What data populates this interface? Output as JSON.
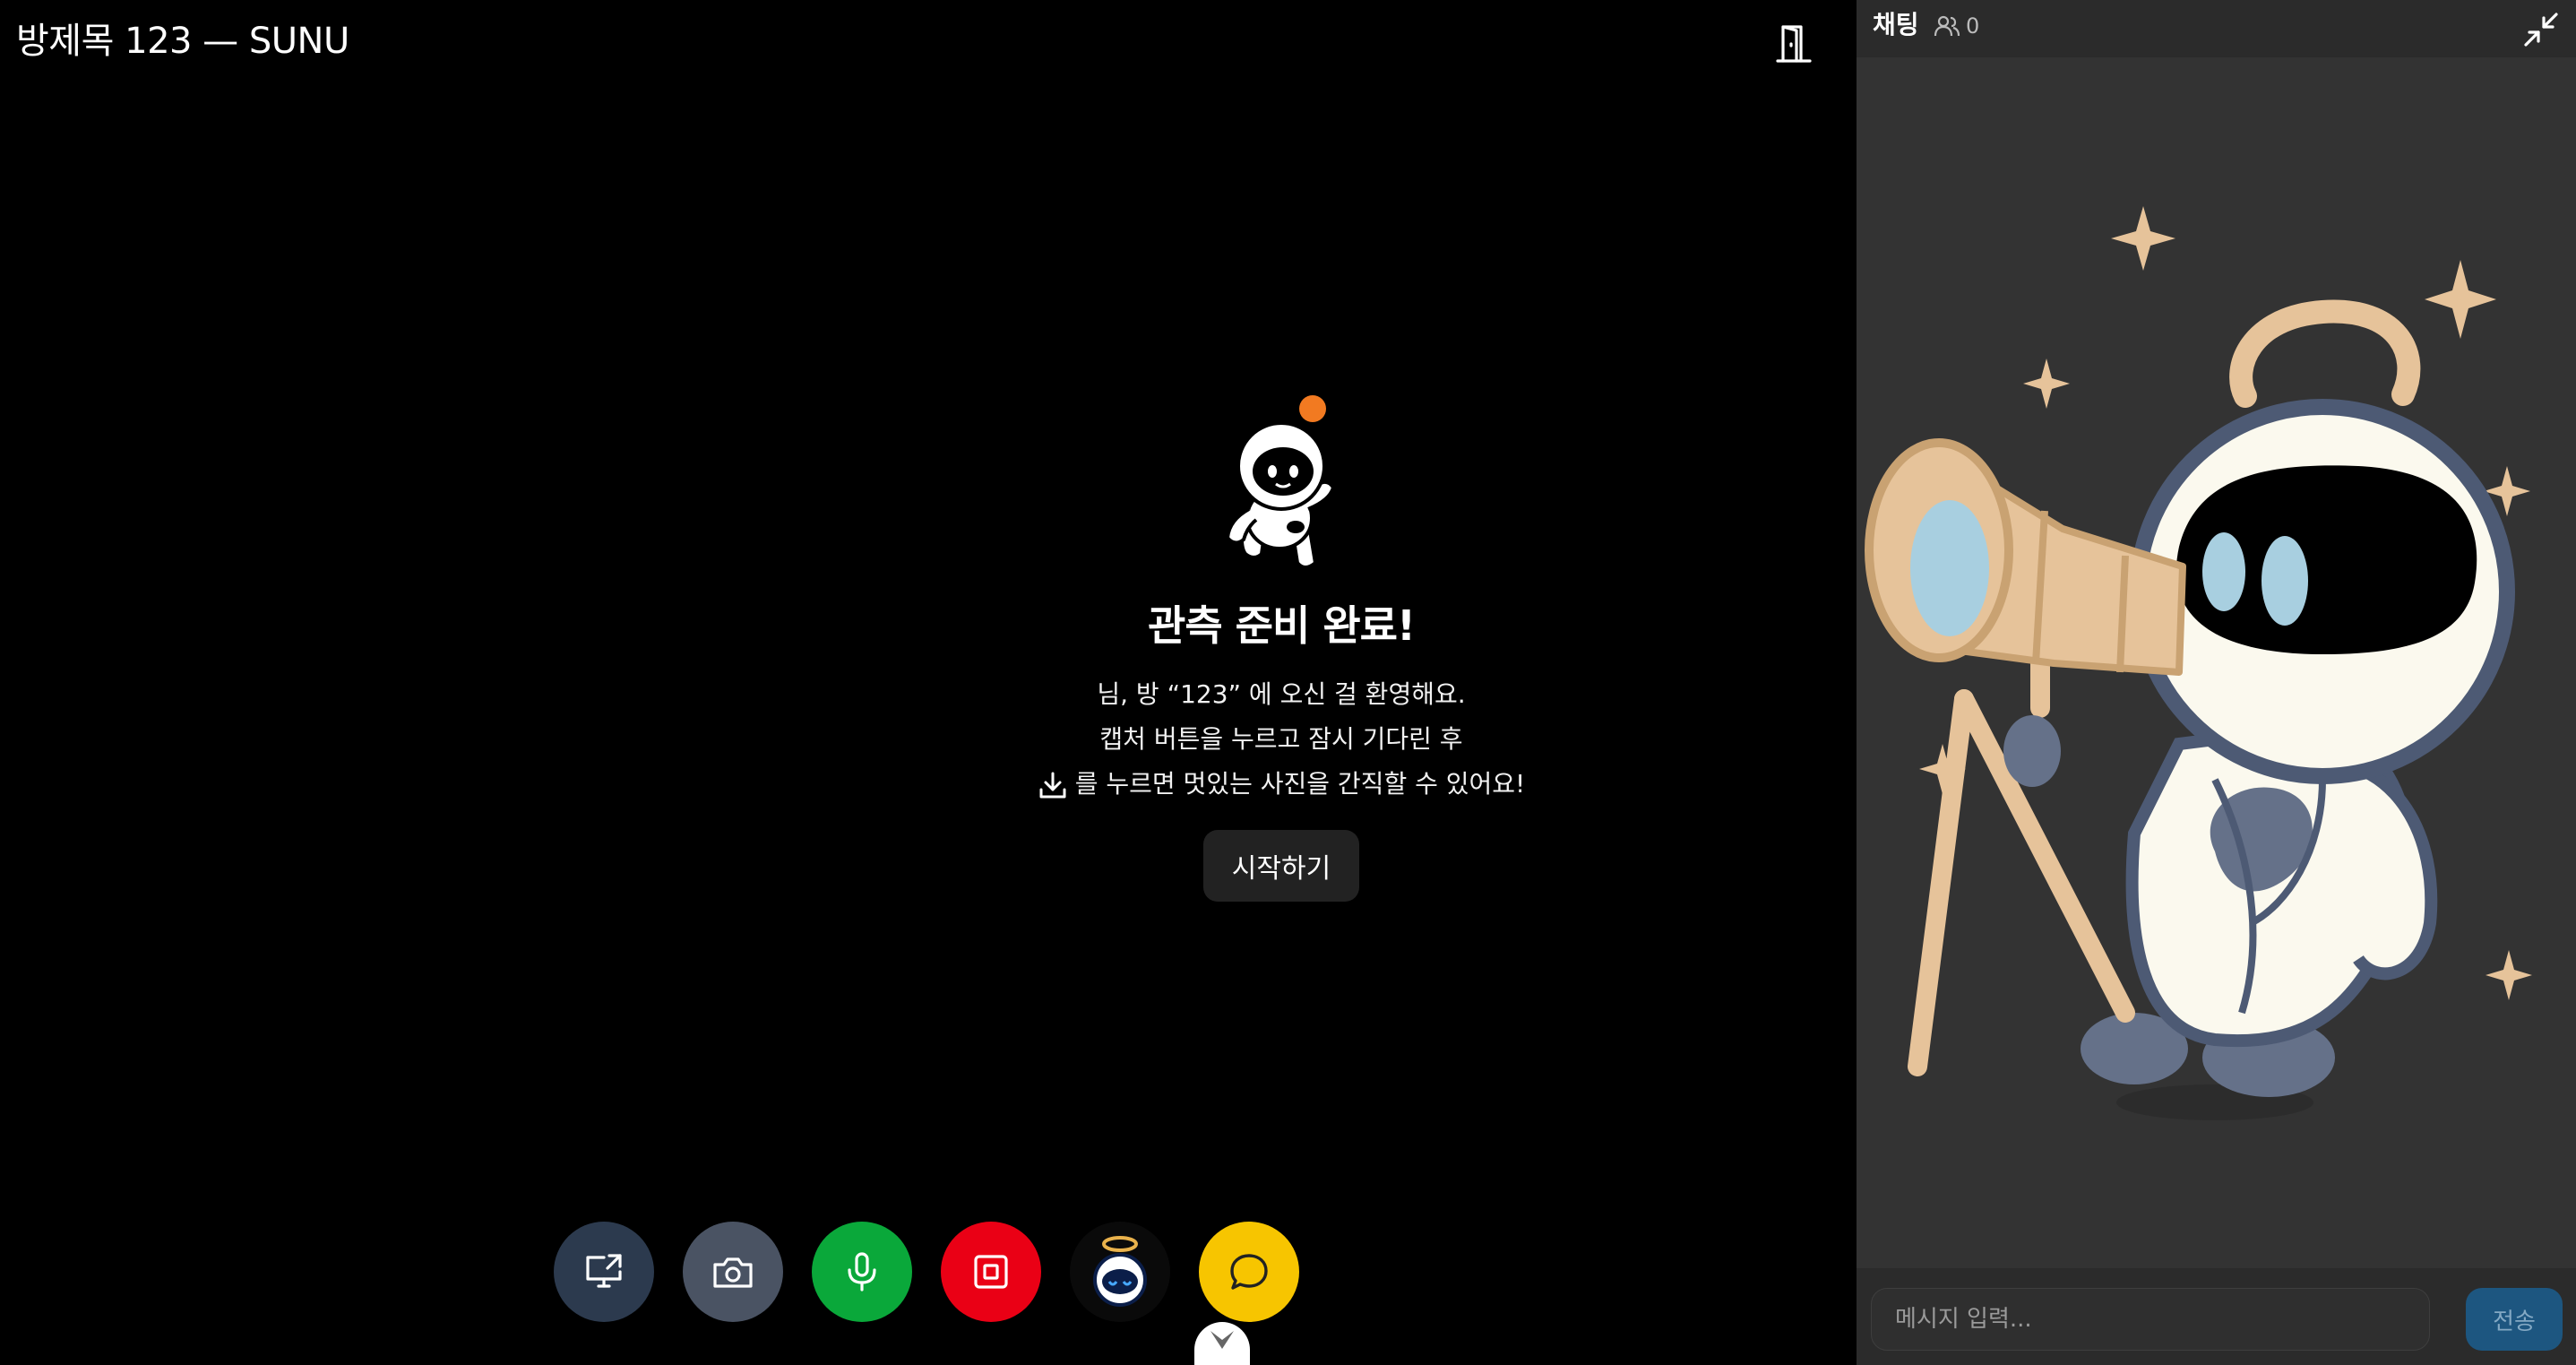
{
  "room": {
    "title": "방제목 123 — SUNU"
  },
  "welcome": {
    "heading": "관측 준비 완료!",
    "line1": "님, 방 “123” 에 오신 걸 환영해요.",
    "line2": "캡처 버튼을 누르고 잠시 기다린 후",
    "line3": "를 누르면 멋있는 사진을 간직할 수 있어요!",
    "start_label": "시작하기"
  },
  "toolbar": {
    "buttons": [
      {
        "icon": "screen-share-icon",
        "color": "#2c3a4e"
      },
      {
        "icon": "camera-icon",
        "color": "#4a5363"
      },
      {
        "icon": "microphone-icon",
        "color": "#0aa83a"
      },
      {
        "icon": "record-stop-icon",
        "color": "#ea0015"
      },
      {
        "icon": "halo-avatar-icon",
        "color": "#0a0a0a"
      },
      {
        "icon": "chat-bubble-icon",
        "color": "#f7c500"
      }
    ]
  },
  "chat": {
    "title": "채팅",
    "participant_count": "0",
    "input_placeholder": "메시지 입력...",
    "send_label": "전송"
  },
  "colors": {
    "accent_orange": "#f27a21",
    "send_button": "#1d5680",
    "chat_bg": "#333333"
  }
}
